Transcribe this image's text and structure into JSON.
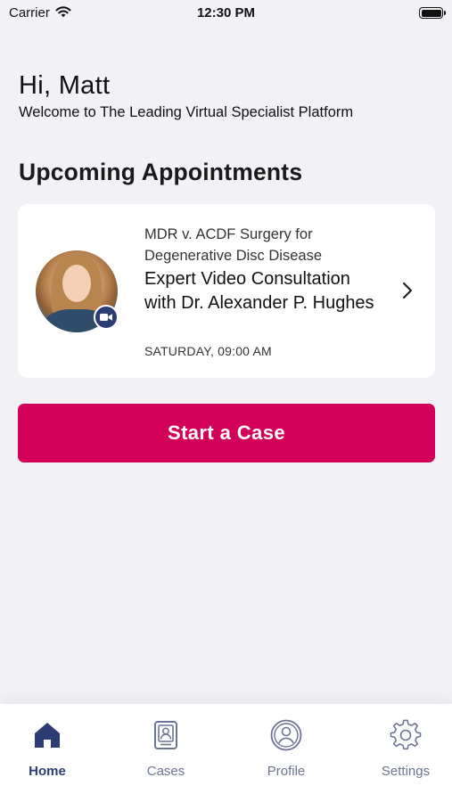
{
  "status_bar": {
    "carrier": "Carrier",
    "time": "12:30 PM"
  },
  "header": {
    "greeting": "Hi, Matt",
    "welcome": "Welcome to The Leading Virtual Specialist Platform"
  },
  "upcoming": {
    "section_title": "Upcoming Appointments",
    "appointments": [
      {
        "subtitle": "MDR v. ACDF Surgery for Degenerative Disc Disease",
        "title": "Expert Video Consultation with Dr. Alexander P. Hughes",
        "time": "SATURDAY, 09:00 AM",
        "avatar_icon": "doctor-avatar",
        "badge_icon": "video-camera-icon"
      }
    ]
  },
  "actions": {
    "start_case_label": "Start a Case"
  },
  "tab_bar": {
    "tabs": [
      {
        "label": "Home",
        "icon": "home-icon",
        "active": true
      },
      {
        "label": "Cases",
        "icon": "cases-icon",
        "active": false
      },
      {
        "label": "Profile",
        "icon": "profile-icon",
        "active": false
      },
      {
        "label": "Settings",
        "icon": "settings-icon",
        "active": false
      }
    ]
  },
  "colors": {
    "background": "#f1f1f6",
    "primary_button": "#d3005a",
    "tab_active": "#2c3d73",
    "tab_inactive": "#6b7490"
  }
}
